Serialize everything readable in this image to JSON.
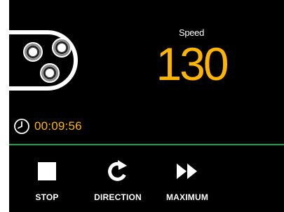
{
  "speed": {
    "label": "Speed",
    "value": "130",
    "color": "#ffb400"
  },
  "timer": {
    "icon": "clock-icon",
    "value": "00:09:56"
  },
  "pump_head": {
    "icon": "peristaltic-pump-head-icon",
    "roller_count": 3
  },
  "controls": {
    "stop": {
      "icon": "stop-icon",
      "label": "STOP"
    },
    "direction": {
      "icon": "rotate-direction-icon",
      "label": "DIRECTION"
    },
    "maximum": {
      "icon": "fast-forward-icon",
      "label": "MAXIMUM"
    }
  },
  "colors": {
    "background": "#000000",
    "accent": "#ffb400",
    "divider": "#13a83e",
    "text": "#ffffff"
  }
}
